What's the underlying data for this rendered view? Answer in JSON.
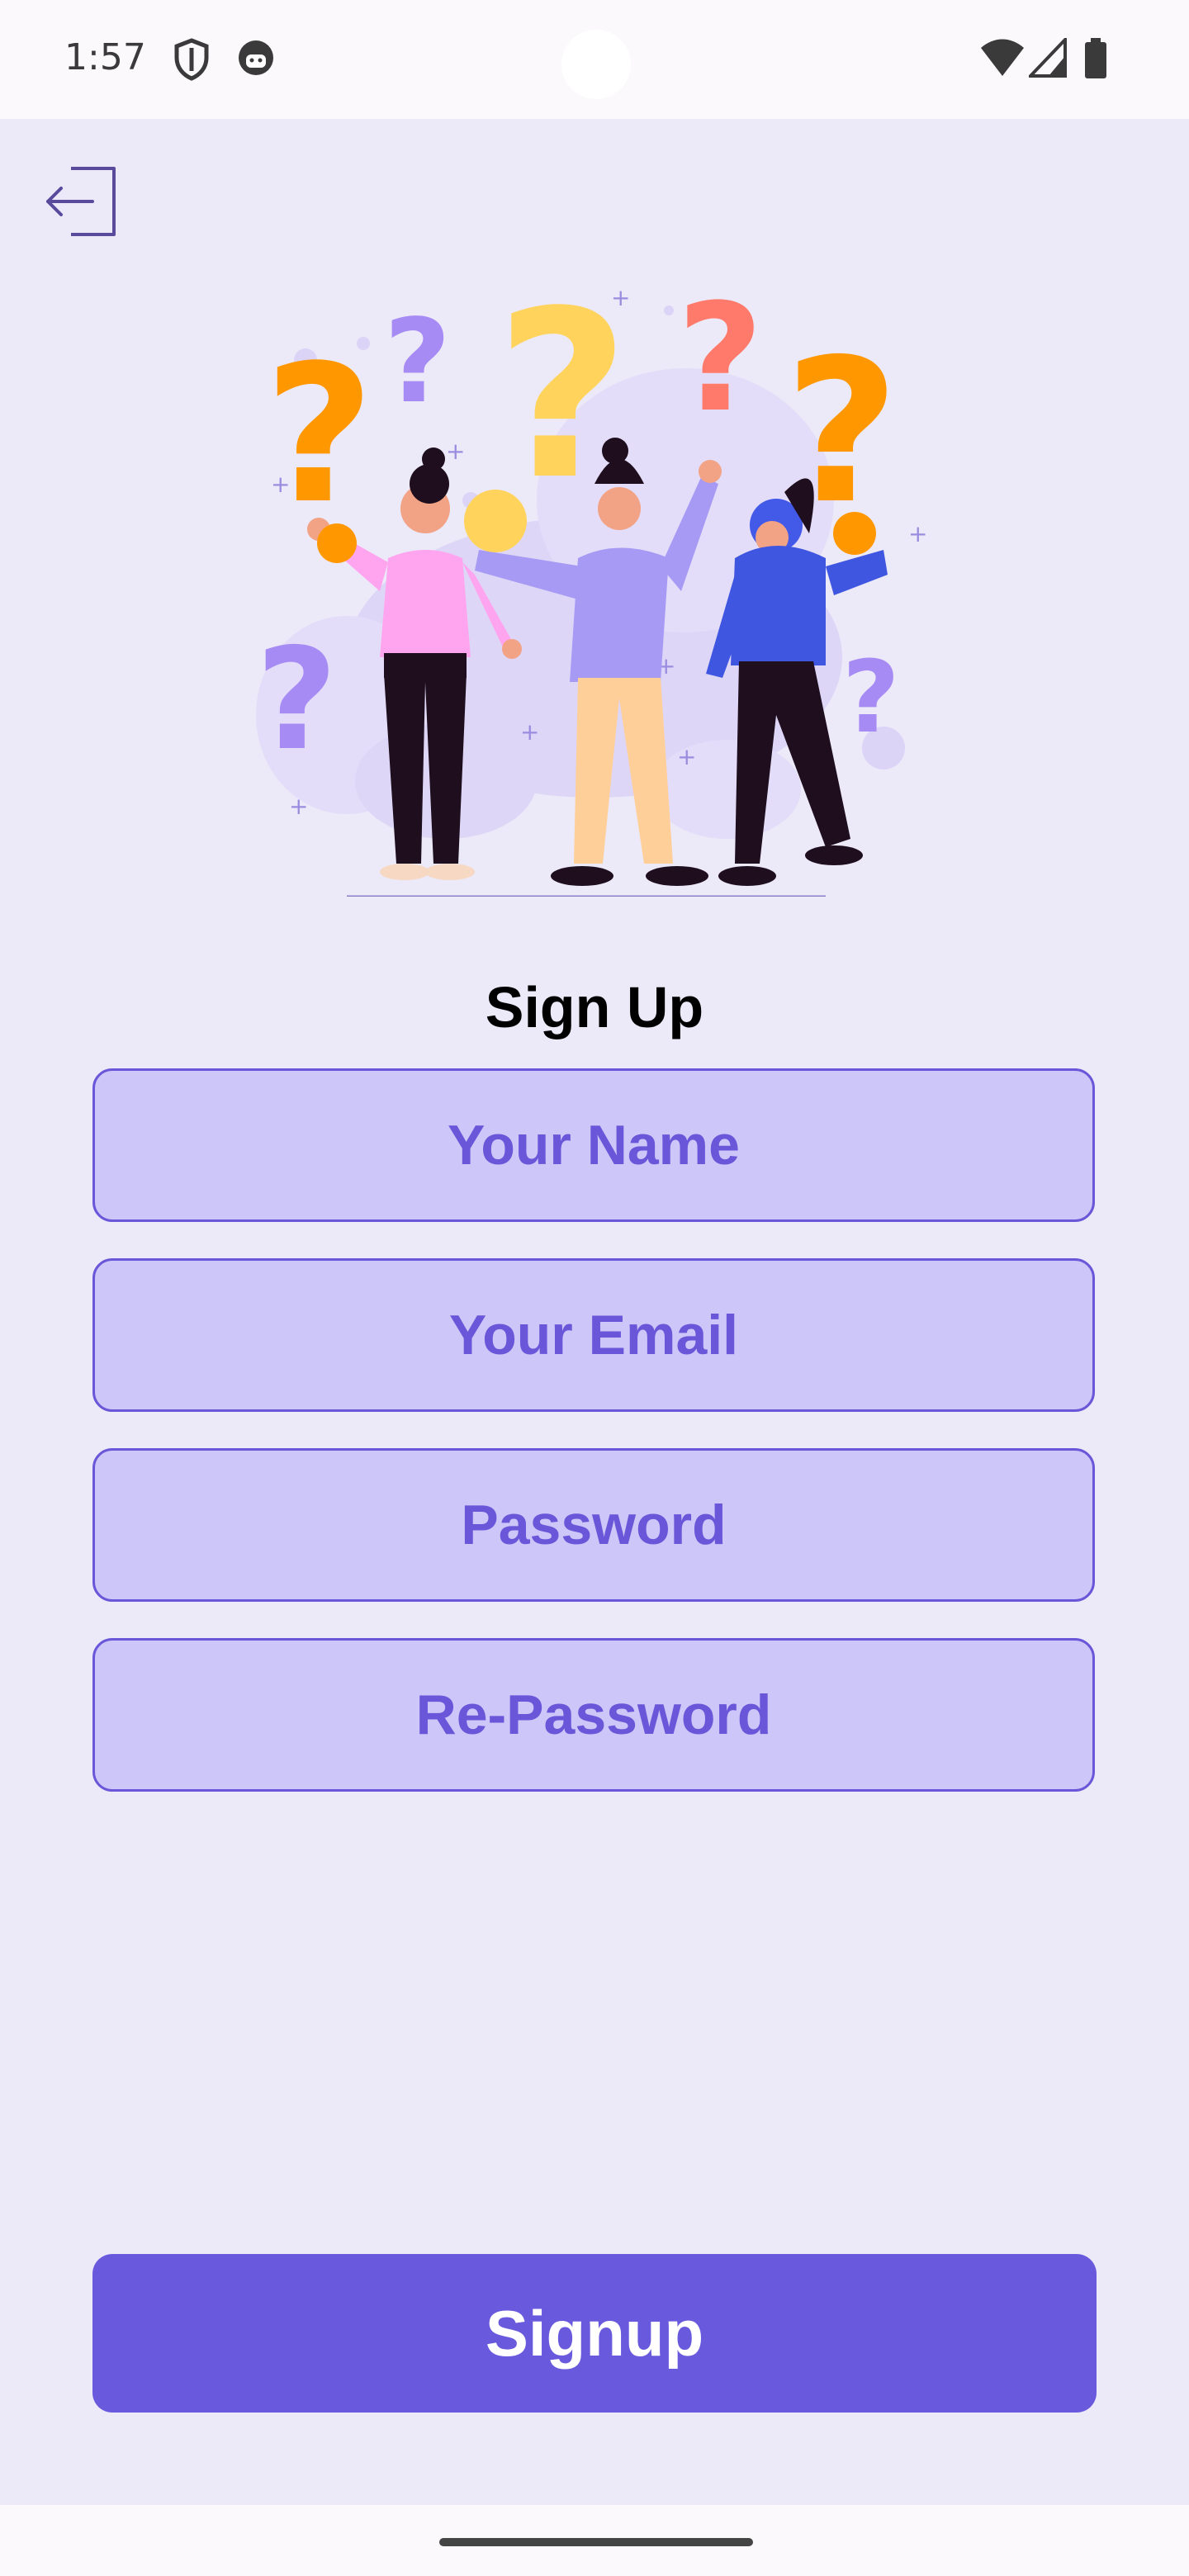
{
  "status_bar": {
    "time": "1:57",
    "icons": [
      "shield-icon",
      "android-face-icon",
      "wifi-icon",
      "signal-icon",
      "battery-icon"
    ]
  },
  "header": {
    "back_icon": "exit-arrow-icon"
  },
  "illustration": {
    "name": "people-with-question-marks-illustration"
  },
  "form": {
    "title": "Sign Up",
    "name_placeholder": "Your Name",
    "email_placeholder": "Your Email",
    "password_placeholder": "Password",
    "repassword_placeholder": "Re-Password"
  },
  "actions": {
    "signup_label": "Signup"
  },
  "colors": {
    "accent": "#6959DD",
    "field_bg": "#CDC6F8",
    "page_bg": "#ECE9F8"
  }
}
